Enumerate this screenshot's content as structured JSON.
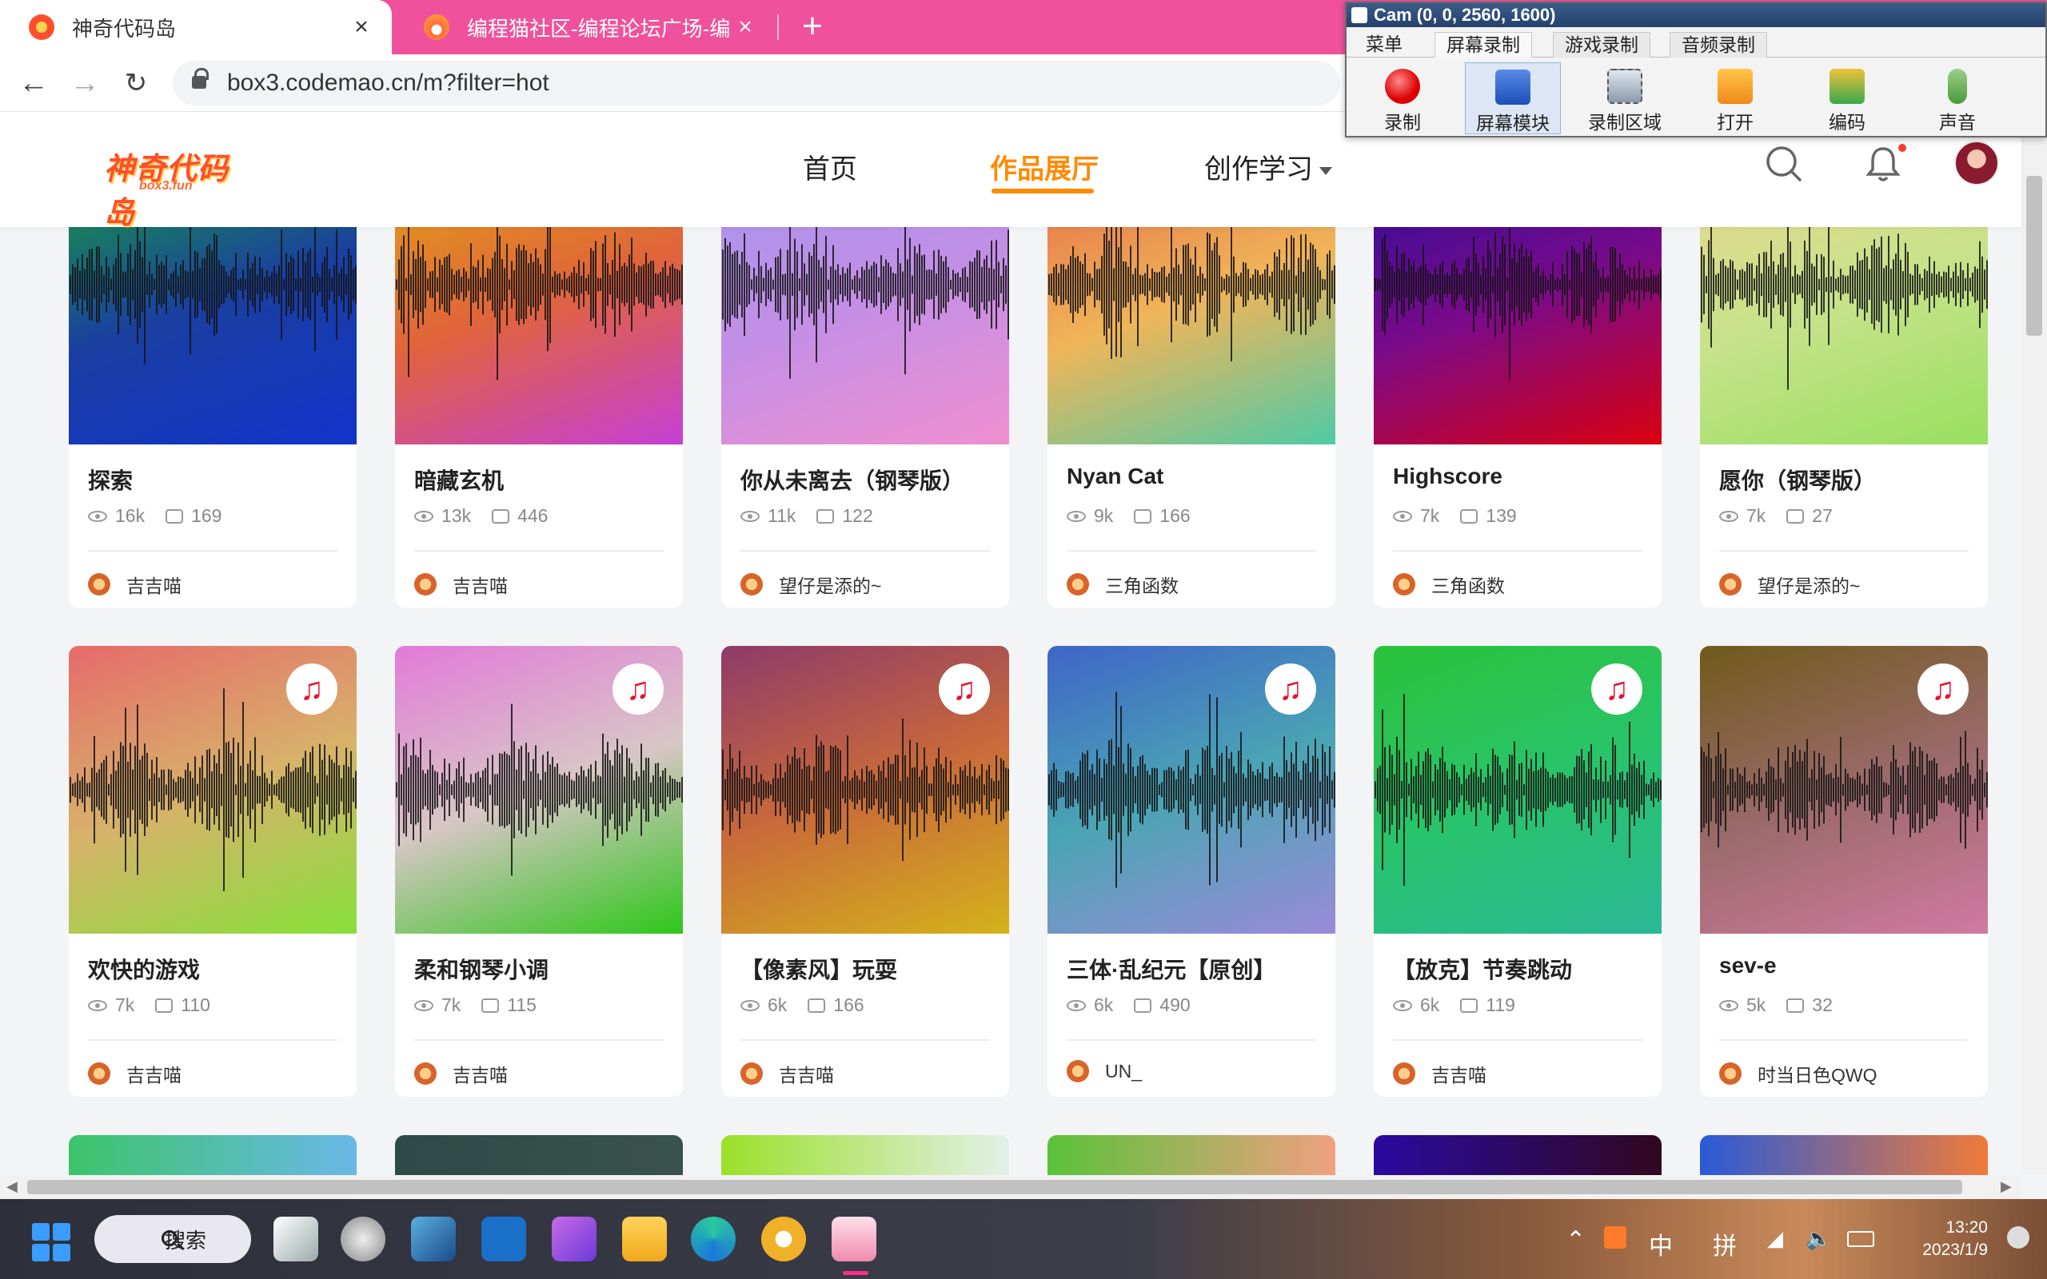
{
  "browser": {
    "tabs": [
      {
        "title": "神奇代码岛",
        "active": true
      },
      {
        "title": "编程猫社区-编程论坛广场-编程学",
        "active": false
      }
    ],
    "close_glyph": "×",
    "new_tab_glyph": "+",
    "url": "box3.codemao.cn/m?filter=hot",
    "accent": "#f0519c"
  },
  "recorder": {
    "title": "Cam (0, 0, 2560, 1600)",
    "tabs": [
      "菜单",
      "屏幕录制",
      "游戏录制",
      "音频录制"
    ],
    "tools": [
      {
        "label": "录制",
        "icon": "record-icon"
      },
      {
        "label": "屏幕模块",
        "icon": "screen-module-icon"
      },
      {
        "label": "录制区域",
        "icon": "record-area-icon"
      },
      {
        "label": "打开",
        "icon": "folder-icon"
      },
      {
        "label": "编码",
        "icon": "encode-icon"
      },
      {
        "label": "声音",
        "icon": "microphone-icon"
      }
    ]
  },
  "site": {
    "logo_text": "神奇代码岛",
    "logo_sub": "box3.fun",
    "nav": [
      {
        "label": "首页",
        "active": false
      },
      {
        "label": "作品展厅",
        "active": true
      },
      {
        "label": "创作学习",
        "active": false,
        "dropdown": true
      }
    ],
    "accent": "#ff8a00"
  },
  "cards": [
    {
      "title": "探索",
      "views": "16k",
      "comments": "169",
      "author": "吉吉喵",
      "grad": [
        "#18a33a",
        "#1a3fa0",
        "#1133cc"
      ],
      "music": false
    },
    {
      "title": "暗藏玄机",
      "views": "13k",
      "comments": "446",
      "author": "吉吉喵",
      "grad": [
        "#e3a316",
        "#e0643a",
        "#c63fd6"
      ],
      "music": false
    },
    {
      "title": "你从未离去（钢琴版）",
      "views": "11k",
      "comments": "122",
      "author": "望仔是添的~",
      "grad": [
        "#a694ee",
        "#c38fe6",
        "#ef8fd0"
      ],
      "music": false
    },
    {
      "title": "Nyan Cat",
      "views": "9k",
      "comments": "166",
      "author": "三角函数",
      "grad": [
        "#e46a48",
        "#f0b558",
        "#4fcaa6"
      ],
      "music": false
    },
    {
      "title": "Highscore",
      "views": "7k",
      "comments": "139",
      "author": "三角函数",
      "grad": [
        "#2a0e9a",
        "#7a0a8a",
        "#d9000f"
      ],
      "music": false
    },
    {
      "title": "愿你（钢琴版）",
      "views": "7k",
      "comments": "27",
      "author": "望仔是添的~",
      "grad": [
        "#e9d88e",
        "#c7e28a",
        "#98e060"
      ],
      "music": false
    },
    {
      "title": "欢快的游戏",
      "views": "7k",
      "comments": "110",
      "author": "吉吉喵",
      "grad": [
        "#e66a6a",
        "#d7b26a",
        "#87e03a"
      ],
      "music": true
    },
    {
      "title": "柔和钢琴小调",
      "views": "7k",
      "comments": "115",
      "author": "吉吉喵",
      "grad": [
        "#e27ad8",
        "#d8c6c6",
        "#2ec71a"
      ],
      "music": true
    },
    {
      "title": "【像素风】玩耍",
      "views": "6k",
      "comments": "166",
      "author": "吉吉喵",
      "grad": [
        "#8f3a6a",
        "#c96a3a",
        "#d4b21a"
      ],
      "music": true
    },
    {
      "title": "三体·乱纪元【原创】",
      "views": "6k",
      "comments": "490",
      "author": "UN_",
      "grad": [
        "#3f65c8",
        "#4aa5b4",
        "#9a8ad8"
      ],
      "music": true
    },
    {
      "title": "【放克】节奏跳动",
      "views": "6k",
      "comments": "119",
      "author": "吉吉喵",
      "grad": [
        "#2bc23a",
        "#28c46a",
        "#2ab896"
      ],
      "music": true
    },
    {
      "title": "sev-e",
      "views": "5k",
      "comments": "32",
      "author": "时当日色QWQ",
      "grad": [
        "#6f5a1a",
        "#9a6a6a",
        "#d07aa0"
      ],
      "music": true
    }
  ],
  "peek_grads": [
    [
      "#3cc46a",
      "#6ab8e8"
    ],
    [
      "#2e4a46",
      "#39524c"
    ],
    [
      "#9be02a",
      "#e2f0e8"
    ],
    [
      "#5ac23a",
      "#f0a080"
    ],
    [
      "#2a0aa0",
      "#300820"
    ],
    [
      "#2a5ad8",
      "#f07a3a"
    ]
  ],
  "music_glyph": "♫",
  "taskbar": {
    "search_label": "搜索",
    "ime_lang": "中",
    "ime_mode": "拼",
    "time": "13:20",
    "date": "2023/1/9"
  }
}
